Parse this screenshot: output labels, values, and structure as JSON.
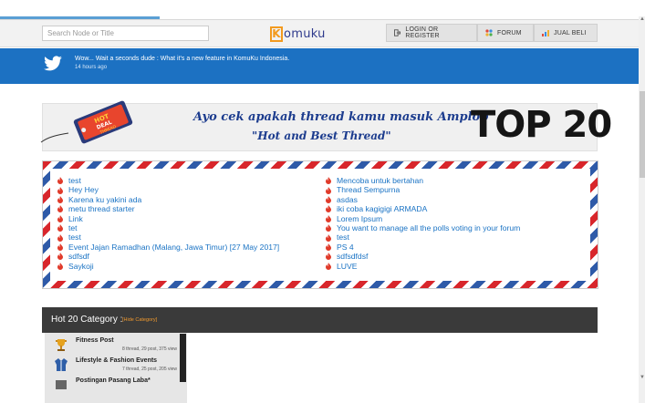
{
  "header": {
    "search_placeholder": "Search Node or Title",
    "logo_letter": "K",
    "logo_rest": "omuku",
    "nav": [
      {
        "label": "LOGIN OR REGISTER",
        "icon": "login-icon"
      },
      {
        "label": "FORUM",
        "icon": "forum-icon"
      },
      {
        "label": "JUAL BELI",
        "icon": "chart-icon"
      }
    ]
  },
  "banner": {
    "message": "Wow... Wait a seconds dude : What it's a new feature in KomuKu Indonesia.",
    "time": "14 hours ago"
  },
  "hot_banner": {
    "tag_text": "HOT DEAL THREAD",
    "line1": "Ayo cek apakah thread kamu masuk Amplop",
    "line2": "\"Hot and Best Thread\"",
    "top": "TOP 20"
  },
  "threads_left": [
    "test",
    "Hey Hey",
    "Karena ku yakini ada",
    "metu thread starter",
    "Link",
    "tet",
    "test",
    "Event Jajan Ramadhan (Malang, Jawa Timur) [27 May 2017]",
    "sdfsdf",
    "Saykoji"
  ],
  "threads_right": [
    "Mencoba untuk bertahan",
    "Thread Sempurna",
    "asdas",
    "iki coba kagigigi ARMADA",
    "Lorem Ipsum",
    "You want to manage all the polls voting in your forum",
    "test",
    "PS 4",
    "sdfsdfdsf",
    "LUVE"
  ],
  "category_section": {
    "title": "Hot 20 Category :",
    "hide_link": "[Hide Category]",
    "items": [
      {
        "name": "Fitness Post",
        "meta": "8 thread, 29 post, 375 view"
      },
      {
        "name": "Lifestyle & Fashion Events",
        "meta": "7 thread, 25 post, 205 view"
      },
      {
        "name": "Postingan Pasang Laba*",
        "meta": ""
      }
    ]
  },
  "colors": {
    "brand_blue": "#1c71c2",
    "accent_orange": "#f39a1e",
    "dark_bar": "#3a3a3a"
  }
}
